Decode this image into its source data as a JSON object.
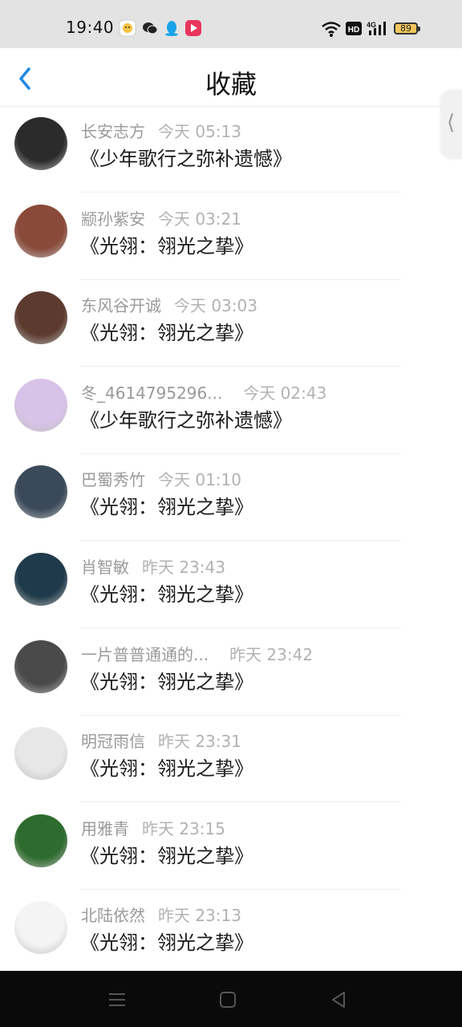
{
  "status_bar": {
    "time": "19:40",
    "icons": [
      "app-notification-icon",
      "wechat-icon",
      "qq-icon",
      "video-app-icon"
    ],
    "right_icons": [
      "wifi-icon",
      "hd-icon",
      "4g-signal-icon"
    ],
    "battery": "89"
  },
  "header": {
    "title": "收藏",
    "back_icon": "chevron-left-icon"
  },
  "side_tab": {
    "glyph": "⟨"
  },
  "items": [
    {
      "user": "长安志方",
      "time": "今天 05:13",
      "book": "《少年歌行之弥补遗憾》",
      "avatar_color": "#2b2b2b"
    },
    {
      "user": "颛孙紫安",
      "time": "今天 03:21",
      "book": "《光翎：翎光之挚》",
      "avatar_color": "#8a4a3a"
    },
    {
      "user": "东风谷开诚",
      "time": "今天 03:03",
      "book": "《光翎：翎光之挚》",
      "avatar_color": "#5c3a2e"
    },
    {
      "user": "冬_4614795296...",
      "time": "今天 02:43",
      "book": "《少年歌行之弥补遗憾》",
      "avatar_color": "#d8c3e8"
    },
    {
      "user": "巴蜀秀竹",
      "time": "今天 01:10",
      "book": "《光翎：翎光之挚》",
      "avatar_color": "#3a4a5a"
    },
    {
      "user": "肖智敏",
      "time": "昨天 23:43",
      "book": "《光翎：翎光之挚》",
      "avatar_color": "#1f3a4a"
    },
    {
      "user": "一片普普通通的...",
      "time": "昨天 23:42",
      "book": "《光翎：翎光之挚》",
      "avatar_color": "#4a4a4a"
    },
    {
      "user": "明冠雨信",
      "time": "昨天 23:31",
      "book": "《光翎：翎光之挚》",
      "avatar_color": "#e7e7e7"
    },
    {
      "user": "用雅青",
      "time": "昨天 23:15",
      "book": "《光翎：翎光之挚》",
      "avatar_color": "#2e6b2e"
    },
    {
      "user": "北陆依然",
      "time": "昨天 23:13",
      "book": "《光翎：翎光之挚》",
      "avatar_color": "#f4f4f4"
    }
  ],
  "colors": {
    "status_bar_bg": "#e3e3e3",
    "accent": "#1e88e5",
    "meta_text": "#9a9a9a",
    "nav_bar_bg": "#0a0a0a"
  }
}
